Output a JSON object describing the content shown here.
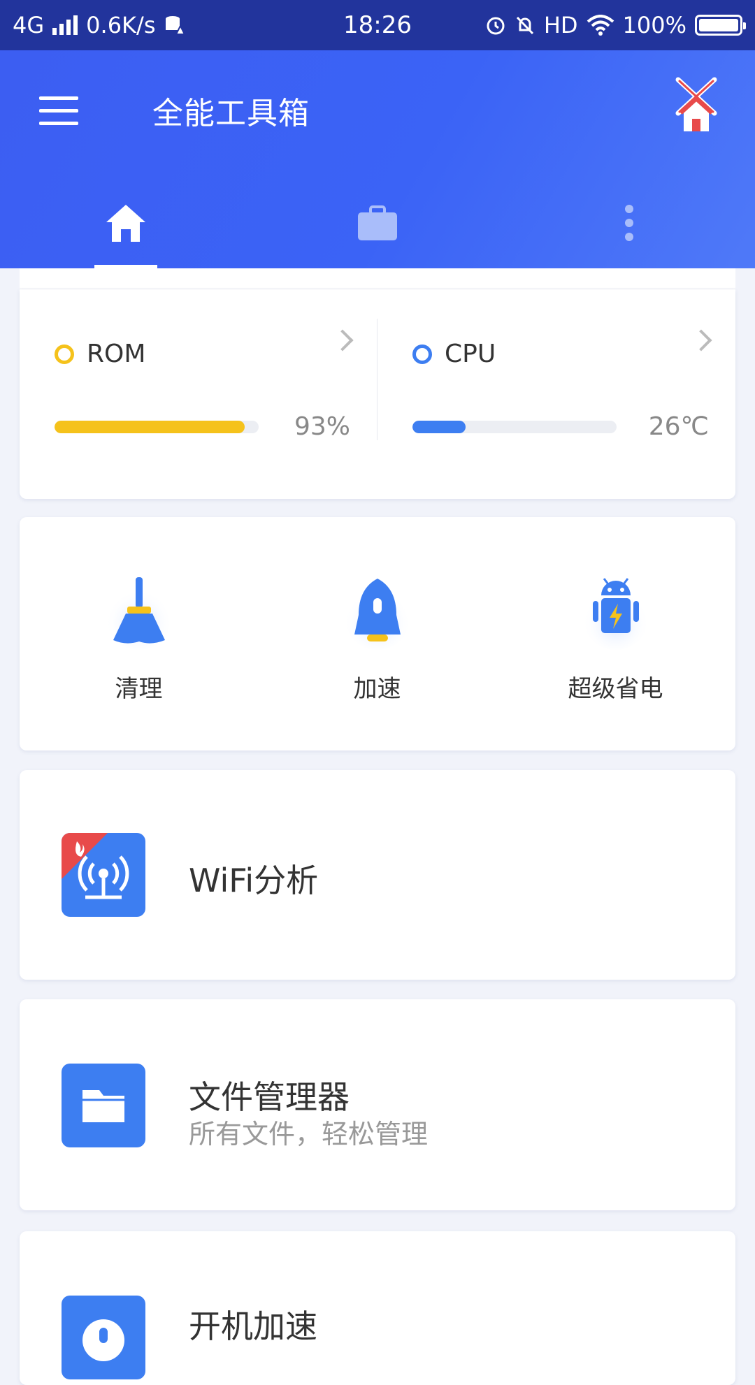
{
  "status": {
    "network": "4G",
    "speed": "0.6K/s",
    "time": "18:26",
    "hd": "HD",
    "battery": "100%"
  },
  "header": {
    "title": "全能工具箱"
  },
  "stats": {
    "rom": {
      "label": "ROM",
      "value": "93%",
      "fill": 0.93,
      "color": "#f5c21b"
    },
    "cpu": {
      "label": "CPU",
      "value": "26℃",
      "fill": 0.26,
      "color": "#3d7ef1"
    }
  },
  "tools": [
    {
      "label": "清理",
      "icon": "broom-icon"
    },
    {
      "label": "加速",
      "icon": "rocket-icon"
    },
    {
      "label": "超级省电",
      "icon": "android-battery-icon"
    }
  ],
  "items": [
    {
      "title": "WiFi分析",
      "subtitle": ""
    },
    {
      "title": "文件管理器",
      "subtitle": "所有文件，轻松管理"
    },
    {
      "title": "开机加速",
      "subtitle": ""
    }
  ],
  "colors": {
    "accent": "#3b63f6",
    "status_bar": "#22349c",
    "hot_badge": "#e84a4a"
  }
}
